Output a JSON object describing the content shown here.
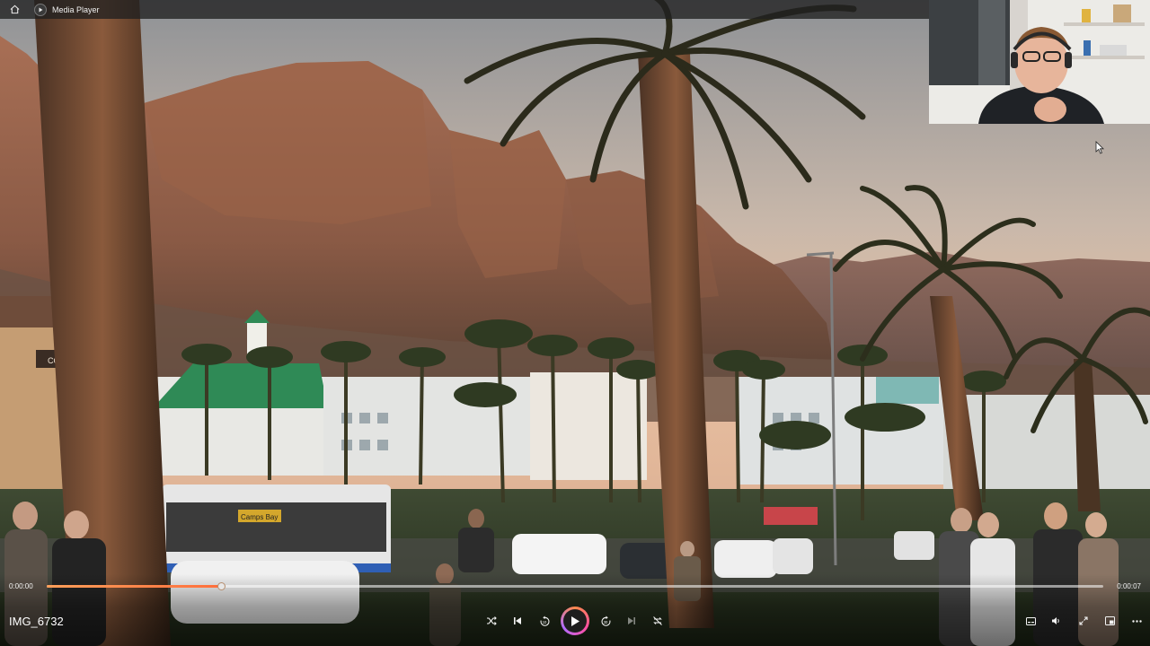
{
  "window": {
    "title": "Media Player",
    "home_icon": "home-icon",
    "app_icon": "media-player-icon"
  },
  "scene": {
    "signage_text": "COLCAC",
    "bus_sign_text": "Camps Bay"
  },
  "player": {
    "current_time": "0:00:00",
    "total_time": "0:00:07",
    "progress": 0.165,
    "file_name": "IMG_6732",
    "accent_color": "#ff7a45",
    "controls": [
      "shuffle-icon",
      "previous-icon",
      "rewind-10-icon",
      "play-icon",
      "forward-30-icon",
      "next-icon",
      "repeat-off-icon"
    ],
    "right_controls": [
      "subtitles-icon",
      "volume-icon",
      "fullscreen-icon",
      "mini-player-icon",
      "more-icon"
    ]
  }
}
